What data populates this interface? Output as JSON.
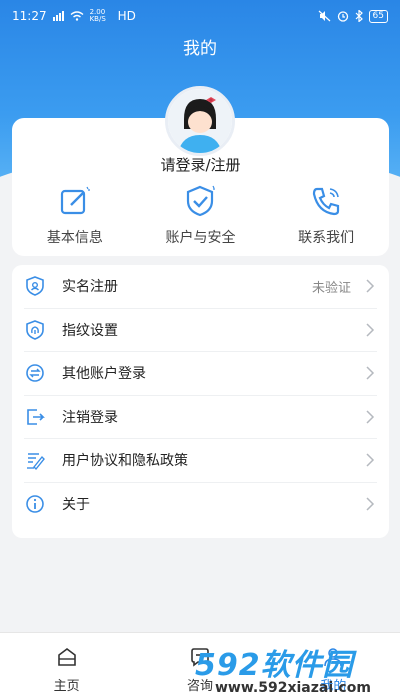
{
  "status_bar": {
    "time": "11:27",
    "network": "HD",
    "speed": "2.00 KB/S",
    "battery": "65"
  },
  "header": {
    "title": "我的"
  },
  "profile": {
    "login_text": "请登录/注册"
  },
  "quick_links": [
    {
      "label": "基本信息",
      "icon": "edit-icon"
    },
    {
      "label": "账户与安全",
      "icon": "shield-check-icon"
    },
    {
      "label": "联系我们",
      "icon": "phone-icon"
    }
  ],
  "menu": [
    {
      "label": "实名注册",
      "status": "未验证",
      "icon": "id-shield-icon"
    },
    {
      "label": "指纹设置",
      "status": "",
      "icon": "fingerprint-shield-icon"
    },
    {
      "label": "其他账户登录",
      "status": "",
      "icon": "switch-account-icon"
    },
    {
      "label": "注销登录",
      "status": "",
      "icon": "logout-icon"
    },
    {
      "label": "用户协议和隐私政策",
      "status": "",
      "icon": "agreement-icon"
    },
    {
      "label": "关于",
      "status": "",
      "icon": "info-icon"
    }
  ],
  "tabbar": [
    {
      "label": "主页",
      "icon": "home-icon"
    },
    {
      "label": "咨询",
      "icon": "chat-icon"
    },
    {
      "label": "我的",
      "icon": "user-icon"
    }
  ],
  "watermark": {
    "brand": "592软件园",
    "url": "www.592xiazai.com"
  },
  "colors": {
    "accent": "#2a86e6",
    "icon_blue": "#3a8ee6"
  }
}
